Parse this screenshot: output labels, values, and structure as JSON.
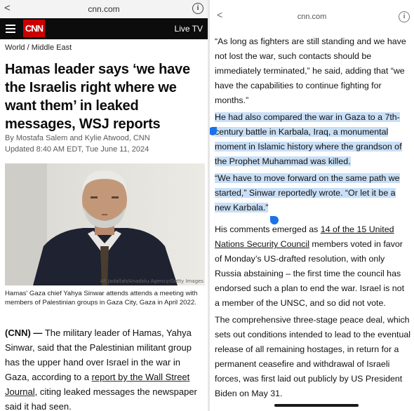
{
  "left": {
    "browser": {
      "url": "cnn.com"
    },
    "nav": {
      "logo": "CNN",
      "live_tv": "Live TV"
    },
    "section": "World / Middle East",
    "headline": "Hamas leader says ‘we have the Israelis right where we want them’ in leaked messages, WSJ reports",
    "byline": "By Mostafa Salem and Kylie Atwood, CNN",
    "updated": "Updated 8:40 AM EDT, Tue June 11, 2024",
    "photo_credit": "Ali Jadallah/Anadolu Agency/Getty Images",
    "caption": "Hamas' Gaza chief Yahya Sinwar attends attends a meeting with members of Palestinian groups in Gaza City, Gaza in April 2022.",
    "body": {
      "dateline": "(CNN) —",
      "text_1": " The military leader of Hamas, Yahya Sinwar, said that the Palestinian militant group has the upper hand over Israel in the war in Gaza, according to a ",
      "link": "report by the Wall Street Journal",
      "text_2": ", citing leaked messages the newspaper said it had seen."
    }
  },
  "right": {
    "browser": {
      "url": "cnn.com"
    },
    "p1": "“As long as fighters are still standing and we have not lost the war, such contacts should be immediately terminated,” he said, adding that “we have the capabilities to continue fighting for months.”",
    "p2": "He had also compared the war in Gaza to a 7th-century battle in Karbala, Iraq, a monumental moment in Islamic history where the grandson of the Prophet Muhammad was killed.",
    "p3": "“We have to move forward on the same path we started,” Sinwar reportedly wrote. “Or let it be a new Karbala.”",
    "p4": {
      "text_1": "His comments emerged as ",
      "link": "14 of the 15 United Nations Security Council",
      "text_2": " members voted in favor of Monday’s US-drafted resolution, with only Russia abstaining – the first time the council has endorsed such a plan to end the war. Israel is not a member of the UNSC, and so did not vote."
    },
    "p5": "The comprehensive three-stage peace deal, which sets out conditions intended to lead to the eventual release of all remaining hostages, in return for a permanent ceasefire and withdrawal of Israeli forces, was first laid out publicly by US President Biden on May 31."
  },
  "colors": {
    "cnn_red": "#cc0000",
    "selection": "#c9dff6",
    "handle": "#1a73e8",
    "nav_bg": "#0c0c0c"
  }
}
